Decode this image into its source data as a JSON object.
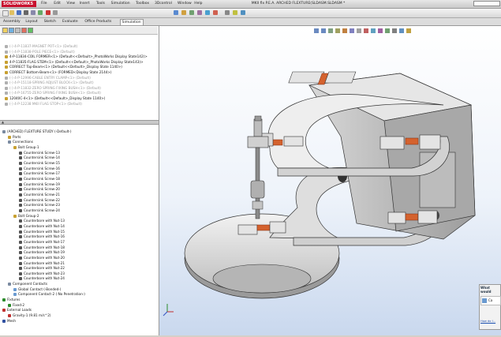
{
  "app": {
    "logo": "SOLIDWORKS",
    "menus": [
      "File",
      "Edit",
      "View",
      "Insert",
      "Tools",
      "Simulation",
      "Toolbox",
      "3Dcontrol",
      "Window",
      "Help"
    ],
    "title": "MKII flx P.E.A. ARCHED FLEXTURE(SLDASM.SLDASM *"
  },
  "tabs": [
    "Assembly",
    "Layout",
    "Sketch",
    "Evaluate",
    "Office Products",
    "Simulation"
  ],
  "active_tab": "Simulation",
  "featuretree": [
    {
      "label": "(-) 4-P-11837-MAGNET POT<1> (Default)",
      "grey": true,
      "color": "#b0b0b0"
    },
    {
      "label": "(-) 4-P-11838-POLE PIECE<1> (Default)",
      "grey": true,
      "color": "#b0b0b0"
    },
    {
      "label": "4-P-11834-COIL FORMER<1> (Default<<Default>_PhotoWorks Display State142)>",
      "grey": false,
      "color": "#c8a030"
    },
    {
      "label": "4-P-11835-FLAG STEM<1> (Default<<Default>_PhotoWorks Display State143)>",
      "grey": false,
      "color": "#c8a030"
    },
    {
      "label": "CORRECT Top-Beam<1> (Default<<Default>_Display State 1140>)",
      "grey": false,
      "color": "#c8a030"
    },
    {
      "label": "CORRECT Bottom-Beam<1> (FORMED<Display State 2144>)",
      "grey": false,
      "color": "#c8a030"
    },
    {
      "label": "(-) 4-P-12996-CABLE ENTRY CLAMP<1> (Default)",
      "grey": true,
      "color": "#b0b0b0"
    },
    {
      "label": "(-) 4-P-15118-SPRING ADJUST BLOCK<1> (Default)",
      "grey": true,
      "color": "#b0b0b0"
    },
    {
      "label": "(-) 4-P-11832-ZERO SPRING FIXING BUSH<1> (Default)",
      "grey": true,
      "color": "#b0b0b0"
    },
    {
      "label": "(-) 4-P-16755-ZERO SPRING FIXING BUSH<1> (Default)",
      "grey": true,
      "color": "#b0b0b0"
    },
    {
      "label": "12040C-4<1> (Default<<Default>_Display State 1140>)",
      "grey": false,
      "color": "#c8a030"
    },
    {
      "label": "(-) 4-P-12238 MKII FLAG STOP<1> (Default)",
      "grey": true,
      "color": "#b0b0b0"
    }
  ],
  "study_tree": [
    {
      "label": "(ARCHED) FLEXTURE STUDY (-Default-)",
      "indent": 0,
      "color": "#7a8aa0"
    },
    {
      "label": "Parts",
      "indent": 1,
      "color": "#c8a030"
    },
    {
      "label": "Connections",
      "indent": 1,
      "color": "#7a8aa0"
    },
    {
      "label": "Bolt Group-1",
      "indent": 2,
      "color": "#c8a030"
    },
    {
      "label": "Countersink Screw-13",
      "indent": 3,
      "color": "#555"
    },
    {
      "label": "Countersink Screw-14",
      "indent": 3,
      "color": "#555"
    },
    {
      "label": "Countersink Screw-15",
      "indent": 3,
      "color": "#555"
    },
    {
      "label": "Countersink Screw-16",
      "indent": 3,
      "color": "#555"
    },
    {
      "label": "Countersink Screw-17",
      "indent": 3,
      "color": "#555"
    },
    {
      "label": "Countersink Screw-18",
      "indent": 3,
      "color": "#555"
    },
    {
      "label": "Countersink Screw-19",
      "indent": 3,
      "color": "#555"
    },
    {
      "label": "Countersink Screw-20",
      "indent": 3,
      "color": "#555"
    },
    {
      "label": "Countersink Screw-21",
      "indent": 3,
      "color": "#555"
    },
    {
      "label": "Countersink Screw-22",
      "indent": 3,
      "color": "#555"
    },
    {
      "label": "Countersink Screw-23",
      "indent": 3,
      "color": "#555"
    },
    {
      "label": "Countersink Screw-24",
      "indent": 3,
      "color": "#555"
    },
    {
      "label": "Bolt Group-2",
      "indent": 2,
      "color": "#c8a030"
    },
    {
      "label": "Counterbore with Nut-13",
      "indent": 3,
      "color": "#555"
    },
    {
      "label": "Counterbore with Nut-14",
      "indent": 3,
      "color": "#555"
    },
    {
      "label": "Counterbore with Nut-15",
      "indent": 3,
      "color": "#555"
    },
    {
      "label": "Counterbore with Nut-16",
      "indent": 3,
      "color": "#555"
    },
    {
      "label": "Counterbore with Nut-17",
      "indent": 3,
      "color": "#555"
    },
    {
      "label": "Counterbore with Nut-18",
      "indent": 3,
      "color": "#555"
    },
    {
      "label": "Counterbore with Nut-19",
      "indent": 3,
      "color": "#555"
    },
    {
      "label": "Counterbore with Nut-20",
      "indent": 3,
      "color": "#555"
    },
    {
      "label": "Counterbore with Nut-21",
      "indent": 3,
      "color": "#555"
    },
    {
      "label": "Counterbore with Nut-22",
      "indent": 3,
      "color": "#555"
    },
    {
      "label": "Counterbore with Nut-23",
      "indent": 3,
      "color": "#555"
    },
    {
      "label": "Counterbore with Nut-24",
      "indent": 3,
      "color": "#555"
    },
    {
      "label": "Component Contacts",
      "indent": 1,
      "color": "#7a8aa0"
    },
    {
      "label": "Global Contact (-Bonded-)",
      "indent": 2,
      "color": "#6a9ad0"
    },
    {
      "label": "Component Contact-2 (-No Penetration-)",
      "indent": 2,
      "color": "#6a9ad0"
    },
    {
      "label": "Fixtures",
      "indent": 0,
      "color": "#2a8a2a"
    },
    {
      "label": "Fixed-2",
      "indent": 1,
      "color": "#2a8a2a"
    },
    {
      "label": "External Loads",
      "indent": 0,
      "color": "#c03030"
    },
    {
      "label": "Gravity-1 (9.81 m/s^2)",
      "indent": 1,
      "color": "#c03030"
    },
    {
      "label": "Mesh",
      "indent": 0,
      "color": "#3050a0"
    }
  ],
  "taskpane": {
    "title": "What would",
    "item": "Ca",
    "link": "How do I..."
  },
  "colors": {
    "part": "#e6e6e6",
    "flexure": "#d4622e",
    "background_top": "#ffffff",
    "background_bottom": "#c9d8ee"
  }
}
